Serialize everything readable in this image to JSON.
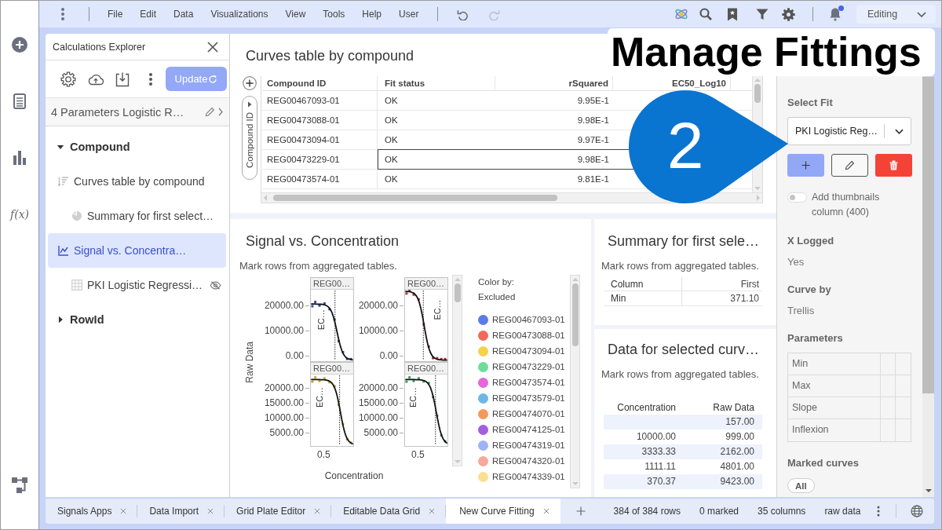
{
  "rail": {
    "formula_label": "f(x)"
  },
  "menu_bar": {
    "items": [
      "File",
      "Edit",
      "Data",
      "Visualizations",
      "View",
      "Tools",
      "Help",
      "User"
    ],
    "history": [
      {
        "kind": "undo",
        "disabled": false
      },
      {
        "kind": "redo",
        "disabled": true
      }
    ],
    "notification_dot": true,
    "mode": "Editing"
  },
  "explorer": {
    "title": "Calculations Explorer",
    "update_label": "Update",
    "calculation": "4 Parameters Logistic R…",
    "tree": [
      {
        "kind": "group",
        "label": "Compound",
        "expanded": true,
        "selected": false,
        "children": [
          {
            "kind": "table",
            "label": "Curves table by compound",
            "selected": false,
            "hidden": false,
            "children": [
              {
                "kind": "pie",
                "label": "Summary for first select…",
                "selected": false,
                "hidden": false
              }
            ]
          },
          {
            "kind": "line",
            "label": "Signal vs. Concentra…",
            "selected": true,
            "hidden": false,
            "children": [
              {
                "kind": "grid",
                "label": "PKI Logistic Regressi…",
                "selected": false,
                "hidden": true
              }
            ]
          }
        ]
      },
      {
        "kind": "group",
        "label": "RowId",
        "expanded": false,
        "selected": false
      }
    ]
  },
  "curves_table": {
    "title": "Curves table by compound",
    "row_header": "Compound ID",
    "columns": [
      "Compound ID",
      "Fit status",
      "rSquared",
      "EC50_Log10"
    ],
    "rows": [
      {
        "cells": [
          "REG00467093-01",
          "OK",
          "9.95E-1"
        ],
        "selected": false
      },
      {
        "cells": [
          "REG00473088-01",
          "OK",
          "9.98E-1"
        ],
        "selected": false
      },
      {
        "cells": [
          "REG00473094-01",
          "OK",
          "9.97E-1"
        ],
        "selected": false
      },
      {
        "cells": [
          "REG00473229-01",
          "OK",
          "9.98E-1"
        ],
        "selected": true
      },
      {
        "cells": [
          "REG00473574-01",
          "OK",
          "9.81E-1"
        ],
        "selected": false
      }
    ]
  },
  "signal_chart": {
    "title": "Signal vs. Concentration",
    "subtitle": "Mark rows from aggregated tables.",
    "ylabel": "Raw Data",
    "xlabel": "Concentration",
    "xtick_labels": [
      "0.5",
      "0.5"
    ],
    "panels": [
      {
        "title": "REG00…",
        "yticks": [
          "20000.00",
          "10000.00",
          "0.00"
        ],
        "ec_label": "EC…",
        "color": "#2f4ea6"
      },
      {
        "title": "REG00…",
        "yticks": [
          "20000.00",
          "10000.00",
          "0.00"
        ],
        "ec_label": "EC…",
        "color": "#a23a2a"
      },
      {
        "title": "REG00…",
        "yticks": [
          "20000.00",
          "15000.00",
          "10000.00",
          "5000.00"
        ],
        "ec_label": "EC…",
        "color": "#c8a12a"
      },
      {
        "title": "REG00…",
        "yticks": [
          "20000.00",
          "15000.00",
          "10000.00",
          "5000.00"
        ],
        "ec_label": "EC…",
        "color": "#3d9a5c"
      }
    ],
    "legend": {
      "title": "Color by:",
      "column": "Excluded",
      "items": [
        {
          "label": "REG00467093-01",
          "color": "#5b7be8"
        },
        {
          "label": "REG00473088-01",
          "color": "#ef6a5a"
        },
        {
          "label": "REG00473094-01",
          "color": "#f5d24a"
        },
        {
          "label": "REG00473229-01",
          "color": "#6fdc9a"
        },
        {
          "label": "REG00473574-01",
          "color": "#e466d8"
        },
        {
          "label": "REG00473579-01",
          "color": "#6db6e8"
        },
        {
          "label": "REG00474070-01",
          "color": "#f29a5c"
        },
        {
          "label": "REG00474125-01",
          "color": "#a45ee0"
        },
        {
          "label": "REG00474319-01",
          "color": "#9fb2f5"
        },
        {
          "label": "REG00474320-01",
          "color": "#f7a89a"
        },
        {
          "label": "REG00474339-01",
          "color": "#f8e090"
        }
      ]
    }
  },
  "summary": {
    "title": "Summary for first sele…",
    "subtitle": "Mark rows from aggregated tables.",
    "columns": [
      "Column",
      "First"
    ],
    "rows": [
      [
        "Min",
        "371.10"
      ]
    ]
  },
  "curve_data": {
    "title": "Data for selected curv…",
    "subtitle": "Mark rows from aggregated tables.",
    "columns": [
      "Concentration",
      "Raw Data"
    ],
    "rows": [
      {
        "raw_data": "157.00"
      },
      {
        "concentration": "10000.00",
        "raw_data": "999.00"
      },
      {
        "concentration": "3333.33",
        "raw_data": "2162.00"
      },
      {
        "concentration": "1111.11",
        "raw_data": "4801.00"
      },
      {
        "concentration": "370.37",
        "raw_data": "9423.00"
      }
    ]
  },
  "fit_panel": {
    "select_label": "Select Fit",
    "selected_fit": "PKI Logistic Reg…",
    "thumbnails": {
      "label": "Add thumbnails column (400)",
      "on": false
    },
    "settings": [
      {
        "label": "X Logged",
        "value": "Yes"
      },
      {
        "label": "Curve by",
        "value": "Trellis"
      }
    ],
    "parameters_label": "Parameters",
    "parameters": [
      "Min",
      "Max",
      "Slope",
      "Inflexion"
    ],
    "marked_label": "Marked curves",
    "marked_filter": "All"
  },
  "tab_bar": {
    "tabs": [
      {
        "label": "Signals Apps",
        "selected": false
      },
      {
        "label": "Data Import",
        "selected": false
      },
      {
        "label": "Grid Plate Editor",
        "selected": false
      },
      {
        "label": "Editable Data Grid",
        "selected": false
      },
      {
        "label": "New Curve Fitting",
        "selected": true
      }
    ],
    "status": [
      "384 of 384 rows",
      "0 marked",
      "35 columns",
      "raw data"
    ]
  },
  "annotation": {
    "title": "Manage Fittings",
    "step": "2"
  }
}
